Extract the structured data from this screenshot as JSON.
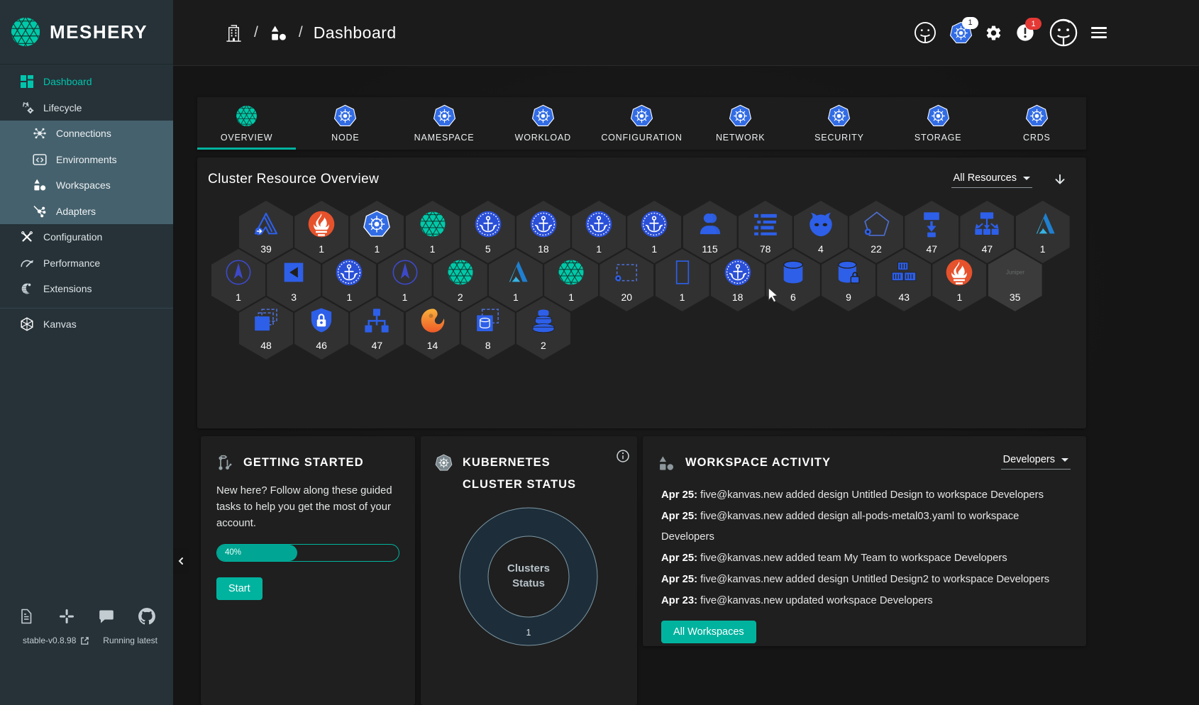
{
  "brand": {
    "name": "MESHERY"
  },
  "sidebar": {
    "items": [
      {
        "id": "dashboard",
        "label": "Dashboard",
        "icon": "dash",
        "active": true,
        "sub": false
      },
      {
        "id": "lifecycle",
        "label": "Lifecycle",
        "icon": "lifecycle",
        "active": false,
        "sub": false
      },
      {
        "id": "connections",
        "label": "Connections",
        "icon": "connections",
        "active": false,
        "sub": true
      },
      {
        "id": "environments",
        "label": "Environments",
        "icon": "environments",
        "active": false,
        "sub": true
      },
      {
        "id": "workspaces",
        "label": "Workspaces",
        "icon": "workspaces",
        "active": false,
        "sub": true
      },
      {
        "id": "adapters",
        "label": "Adapters",
        "icon": "adapters",
        "active": false,
        "sub": true
      },
      {
        "id": "configuration",
        "label": "Configuration",
        "icon": "configuration",
        "active": false,
        "sub": false
      },
      {
        "id": "performance",
        "label": "Performance",
        "icon": "performance",
        "active": false,
        "sub": false
      },
      {
        "id": "extensions",
        "label": "Extensions",
        "icon": "extensions",
        "active": false,
        "sub": false
      }
    ],
    "secondary": [
      {
        "id": "kanvas",
        "label": "Kanvas",
        "icon": "kanvas"
      }
    ],
    "footer": {
      "version": "stable-v0.8.98",
      "status": "Running latest"
    }
  },
  "header": {
    "breadcrumb_current": "Dashboard",
    "kubernetes_badge": "1",
    "alerts_badge": "1"
  },
  "tabs": [
    {
      "label": "OVERVIEW",
      "icon": "meshery",
      "active": true
    },
    {
      "label": "NODE",
      "icon": "kubernetes",
      "active": false
    },
    {
      "label": "NAMESPACE",
      "icon": "kubernetes",
      "active": false
    },
    {
      "label": "WORKLOAD",
      "icon": "kubernetes",
      "active": false
    },
    {
      "label": "CONFIGURATION",
      "icon": "kubernetes",
      "active": false
    },
    {
      "label": "NETWORK",
      "icon": "kubernetes",
      "active": false
    },
    {
      "label": "SECURITY",
      "icon": "kubernetes",
      "active": false
    },
    {
      "label": "STORAGE",
      "icon": "kubernetes",
      "active": false
    },
    {
      "label": "CRDS",
      "icon": "kubernetes",
      "active": false
    }
  ],
  "overview": {
    "title": "Cluster Resource Overview",
    "filter_label": "All Resources",
    "rows": [
      [
        {
          "icon": "peak",
          "count": "39"
        },
        {
          "icon": "prometheus",
          "count": "1"
        },
        {
          "icon": "kubernetes",
          "count": "1"
        },
        {
          "icon": "meshery",
          "count": "1"
        },
        {
          "icon": "anchor",
          "count": "5"
        },
        {
          "icon": "anchor",
          "count": "18"
        },
        {
          "icon": "anchor",
          "count": "1"
        },
        {
          "icon": "anchor",
          "count": "1"
        },
        {
          "icon": "user",
          "count": "115"
        },
        {
          "icon": "list",
          "count": "78"
        },
        {
          "icon": "daemon",
          "count": "4"
        },
        {
          "icon": "pentagon",
          "count": "22"
        },
        {
          "icon": "deploy",
          "count": "47"
        },
        {
          "icon": "sitemap",
          "count": "47"
        },
        {
          "icon": "azure",
          "count": "1"
        }
      ],
      [
        {
          "icon": "compass",
          "count": "1"
        },
        {
          "icon": "backsquare",
          "count": "3"
        },
        {
          "icon": "anchor",
          "count": "1"
        },
        {
          "icon": "compass",
          "count": "1"
        },
        {
          "icon": "meshery",
          "count": "2"
        },
        {
          "icon": "azure",
          "count": "1"
        },
        {
          "icon": "meshery",
          "count": "1"
        },
        {
          "icon": "dashedbox",
          "count": "20"
        },
        {
          "icon": "rectoutline",
          "count": "1"
        },
        {
          "icon": "anchor",
          "count": "18"
        },
        {
          "icon": "database",
          "count": "6"
        },
        {
          "icon": "databaselock",
          "count": "9"
        },
        {
          "icon": "containers",
          "count": "43"
        },
        {
          "icon": "prometheus",
          "count": "1"
        },
        {
          "icon": "juniper",
          "count": "35",
          "faded": true
        }
      ],
      [
        {
          "icon": "copies",
          "count": "48"
        },
        {
          "icon": "shieldlock",
          "count": "46"
        },
        {
          "icon": "flowtree",
          "count": "47"
        },
        {
          "icon": "grafana",
          "count": "14"
        },
        {
          "icon": "cubecopies",
          "count": "8"
        },
        {
          "icon": "discstack",
          "count": "2"
        }
      ]
    ]
  },
  "cards": {
    "getting_started": {
      "title": "GETTING STARTED",
      "body": "New here? Follow along these guided tasks to help you get the most of your account.",
      "progress_label": "40%",
      "progress_value": 40,
      "button": "Start"
    },
    "cluster_status": {
      "title": "KUBERNETES CLUSTER STATUS",
      "center_line1": "Clusters",
      "center_line2": "Status",
      "segment_count": "1"
    },
    "workspace_activity": {
      "title": "WORKSPACE ACTIVITY",
      "filter_label": "Developers",
      "button": "All Workspaces",
      "items": [
        {
          "date": "Apr 25",
          "text": "five@kanvas.new added design Untitled Design to workspace Developers"
        },
        {
          "date": "Apr 25",
          "text": "five@kanvas.new added design all-pods-metal03.yaml to workspace Developers"
        },
        {
          "date": "Apr 25",
          "text": "five@kanvas.new added team My Team to workspace Developers"
        },
        {
          "date": "Apr 25",
          "text": "five@kanvas.new added design Untitled Design2 to workspace Developers"
        },
        {
          "date": "Apr 23",
          "text": "five@kanvas.new updated workspace Developers"
        }
      ]
    }
  },
  "colors": {
    "accent": "#00B39F",
    "kubernetes_blue": "#326CE5",
    "icon_blue": "#2D5FE8",
    "prometheus_orange": "#E6522C",
    "grafana_orange": "#F46800",
    "sidebar_bg": "#263238",
    "sidebar_highlight": "#45616D"
  }
}
